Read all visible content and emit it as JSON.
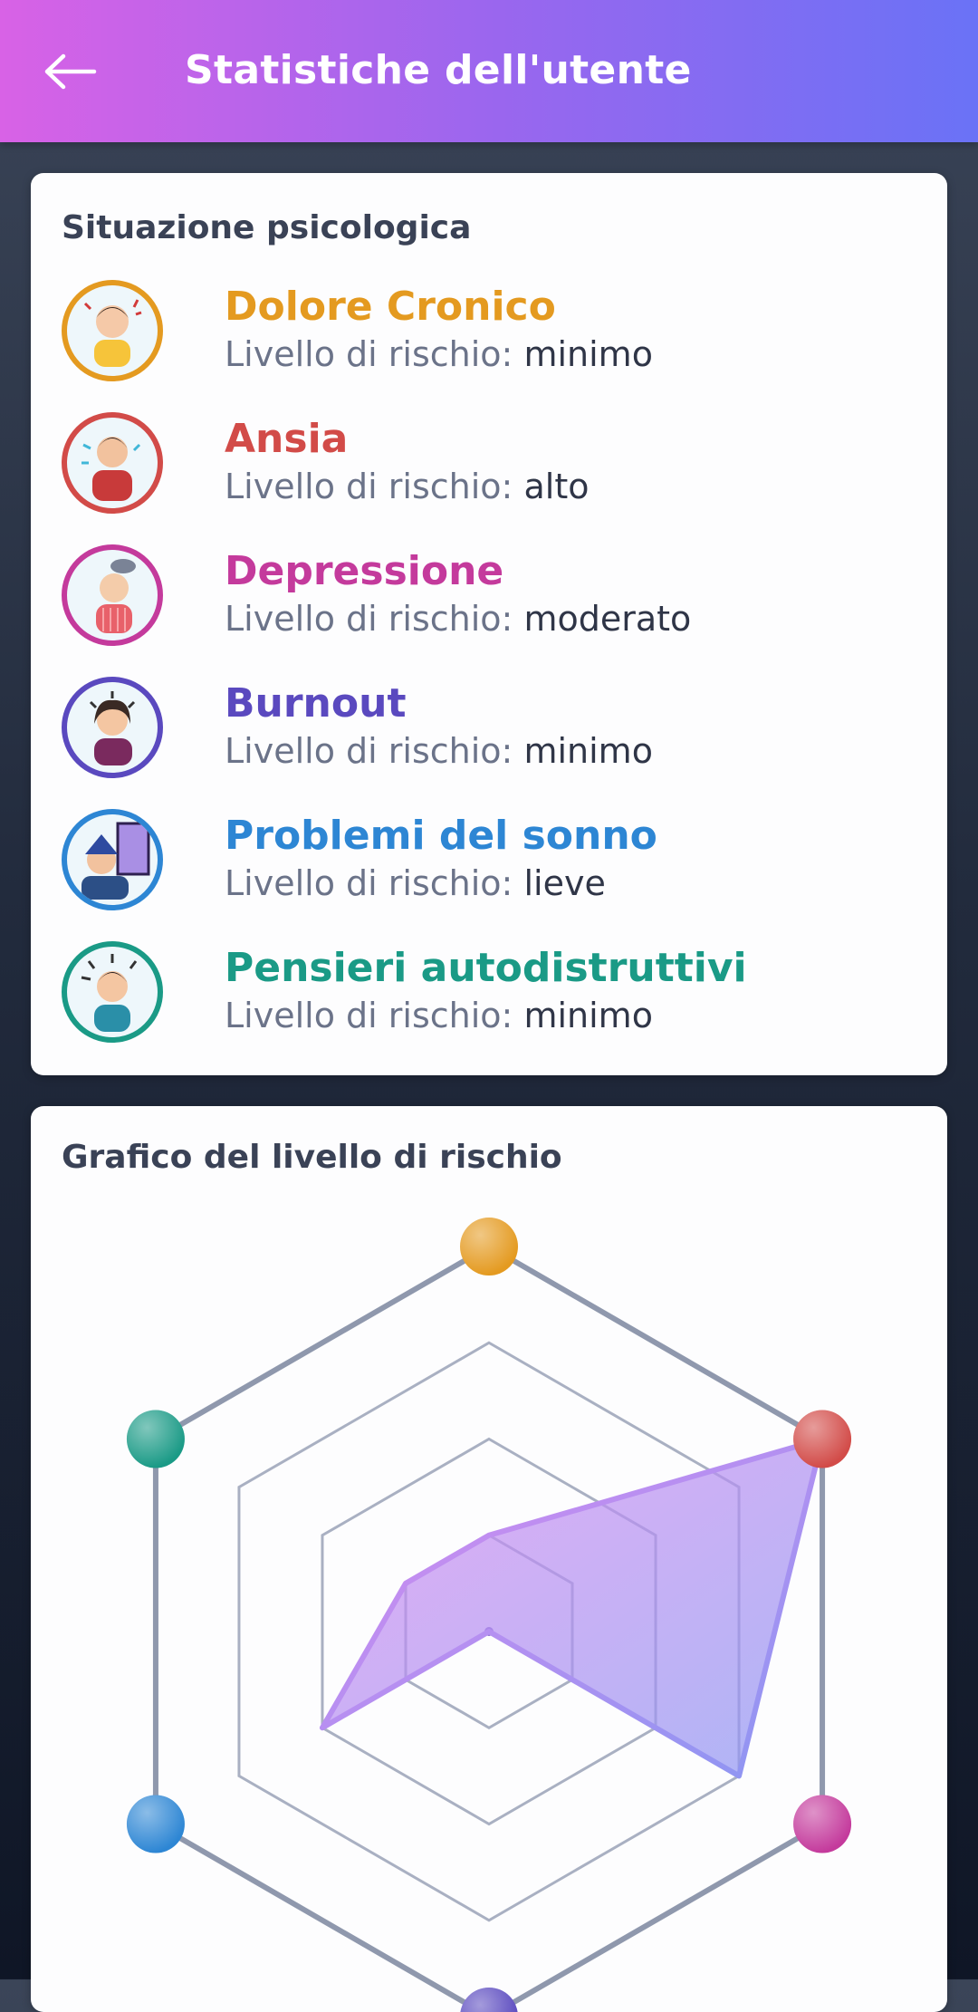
{
  "header": {
    "title": "Statistiche dell'utente",
    "back_icon": "arrow-left-icon"
  },
  "situation": {
    "title": "Situazione psicologica",
    "risk_prefix": "Livello di rischio:",
    "items": [
      {
        "name": "Dolore Cronico",
        "level": "minimo",
        "color": "#e49a20"
      },
      {
        "name": "Ansia",
        "level": "alto",
        "color": "#d24b48"
      },
      {
        "name": "Depressione",
        "level": "moderato",
        "color": "#c43a9c"
      },
      {
        "name": "Burnout",
        "level": "minimo",
        "color": "#5a49bf"
      },
      {
        "name": "Problemi del sonno",
        "level": "lieve",
        "color": "#2d86d4"
      },
      {
        "name": "Pensieri autodistruttivi",
        "level": "minimo",
        "color": "#1a9a86"
      }
    ]
  },
  "chart_section": {
    "title": "Grafico del livello di rischio"
  },
  "chart_data": {
    "type": "radar",
    "axes": [
      "Dolore Cronico",
      "Ansia",
      "Depressione",
      "Burnout",
      "Problemi del sonno",
      "Pensieri autodistruttivi"
    ],
    "axis_colors": [
      "#e49a20",
      "#d24b48",
      "#c43a9c",
      "#5a49bf",
      "#2d86d4",
      "#1a9a86"
    ],
    "scale_levels": 4,
    "values": [
      1,
      4,
      3,
      0,
      2,
      1
    ],
    "series_colors": [
      "#d88af0",
      "#8b96f2"
    ]
  }
}
